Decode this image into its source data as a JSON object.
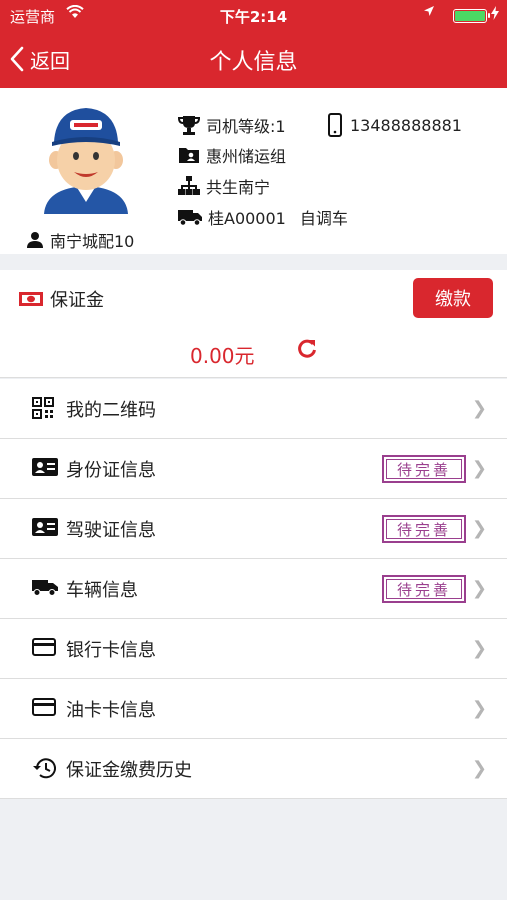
{
  "status_bar": {
    "carrier": "运营商",
    "time": "下午2:14",
    "battery_level": 1.0
  },
  "nav": {
    "back_label": "返回",
    "title": "个人信息"
  },
  "profile": {
    "name": "南宁城配10",
    "driver_level": "司机等级:1",
    "phone": "13488888881",
    "group": "惠州储运组",
    "org": "共生南宁",
    "plate": "桂A00001",
    "vehicle_type": "自调车",
    "avatar_icon": "driver-avatar"
  },
  "deposit": {
    "title": "保证金",
    "pay_label": "缴款",
    "amount": "0.00元"
  },
  "menu": [
    {
      "label": "我的二维码",
      "icon": "qrcode-icon",
      "badge": ""
    },
    {
      "label": "身份证信息",
      "icon": "id-card-icon",
      "badge": "待完善"
    },
    {
      "label": "驾驶证信息",
      "icon": "license-icon",
      "badge": "待完善"
    },
    {
      "label": "车辆信息",
      "icon": "truck-icon",
      "badge": "待完善"
    },
    {
      "label": "银行卡信息",
      "icon": "bank-card-icon",
      "badge": ""
    },
    {
      "label": "油卡卡信息",
      "icon": "fuel-card-icon",
      "badge": ""
    },
    {
      "label": "保证金缴费历史",
      "icon": "history-icon",
      "badge": ""
    }
  ],
  "colors": {
    "primary": "#d9272e",
    "stamp": "#9a3f8e",
    "battery": "#4cd964"
  }
}
